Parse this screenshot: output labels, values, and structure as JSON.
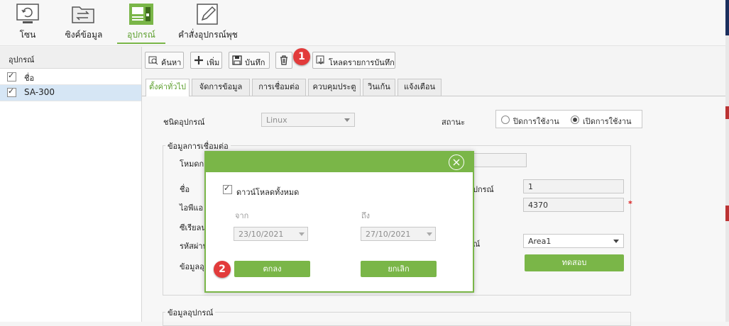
{
  "nav": {
    "items": [
      {
        "label": "โซน",
        "icon": "refresh-screen-icon"
      },
      {
        "label": "ซิงค์ข้อมูล",
        "icon": "sync-folder-icon"
      },
      {
        "label": "อุปกรณ์",
        "icon": "device-terminal-icon",
        "active": true
      },
      {
        "label": "คำสั่งอุปกรณ์พุช",
        "icon": "edit-command-icon"
      }
    ]
  },
  "sidebar": {
    "header": "อุปกรณ์",
    "column_label": "ชื่อ",
    "devices": [
      {
        "name": "SA-300",
        "checked": true
      }
    ]
  },
  "toolbar": {
    "search": "ค้นหา",
    "add": "เพิ่ม",
    "save": "บันทึก",
    "download_records": "โหลดรายการบันทึก",
    "badge_1": "1",
    "badge_2": "2"
  },
  "tabs": [
    "ตั้งค่าทั่วไป",
    "จัดการข้อมูล",
    "การเชื่อมต่อ",
    "ควบคุมประตู",
    "วินเก้น",
    "แจ้งเตือน"
  ],
  "form": {
    "device_type_label": "ชนิดอุปกรณ์",
    "device_type_value": "Linux",
    "status_label": "สถานะ",
    "status_options": [
      {
        "label": "ปิดการใช้งาน",
        "selected": false
      },
      {
        "label": "เปิดการใช้งาน",
        "selected": true
      }
    ],
    "connection_section": "ข้อมูลการเชื่อมต่อ",
    "mode_label": "โหมดกา",
    "name_label": "ชื่อ",
    "ip_label": "ไอพีแอ",
    "serial_label": "ซีเรียลน",
    "password_label": "รหัสผ่าน",
    "data_label": "ข้อมูลอุ",
    "device_no_label": "ปกรณ์",
    "device_no_value": "1",
    "port_value": "4370",
    "required_mark": "*",
    "area_label": "ณ์",
    "area_value": "Area1",
    "test_button": "ทดสอบ",
    "device_section": "ข้อมูลอุปกรณ์"
  },
  "dialog": {
    "download_all_label": "ดาวน์โหลดทั้งหมด",
    "download_all_checked": true,
    "from_label": "จาก",
    "from_date": "23/10/2021",
    "to_label": "ถึง",
    "to_date": "27/10/2021",
    "ok_button": "ตกลง",
    "cancel_button": "ยกเลิก"
  },
  "colors": {
    "accent": "#7ab648",
    "badge": "#e23b3b",
    "selection": "#d6e6f5"
  }
}
